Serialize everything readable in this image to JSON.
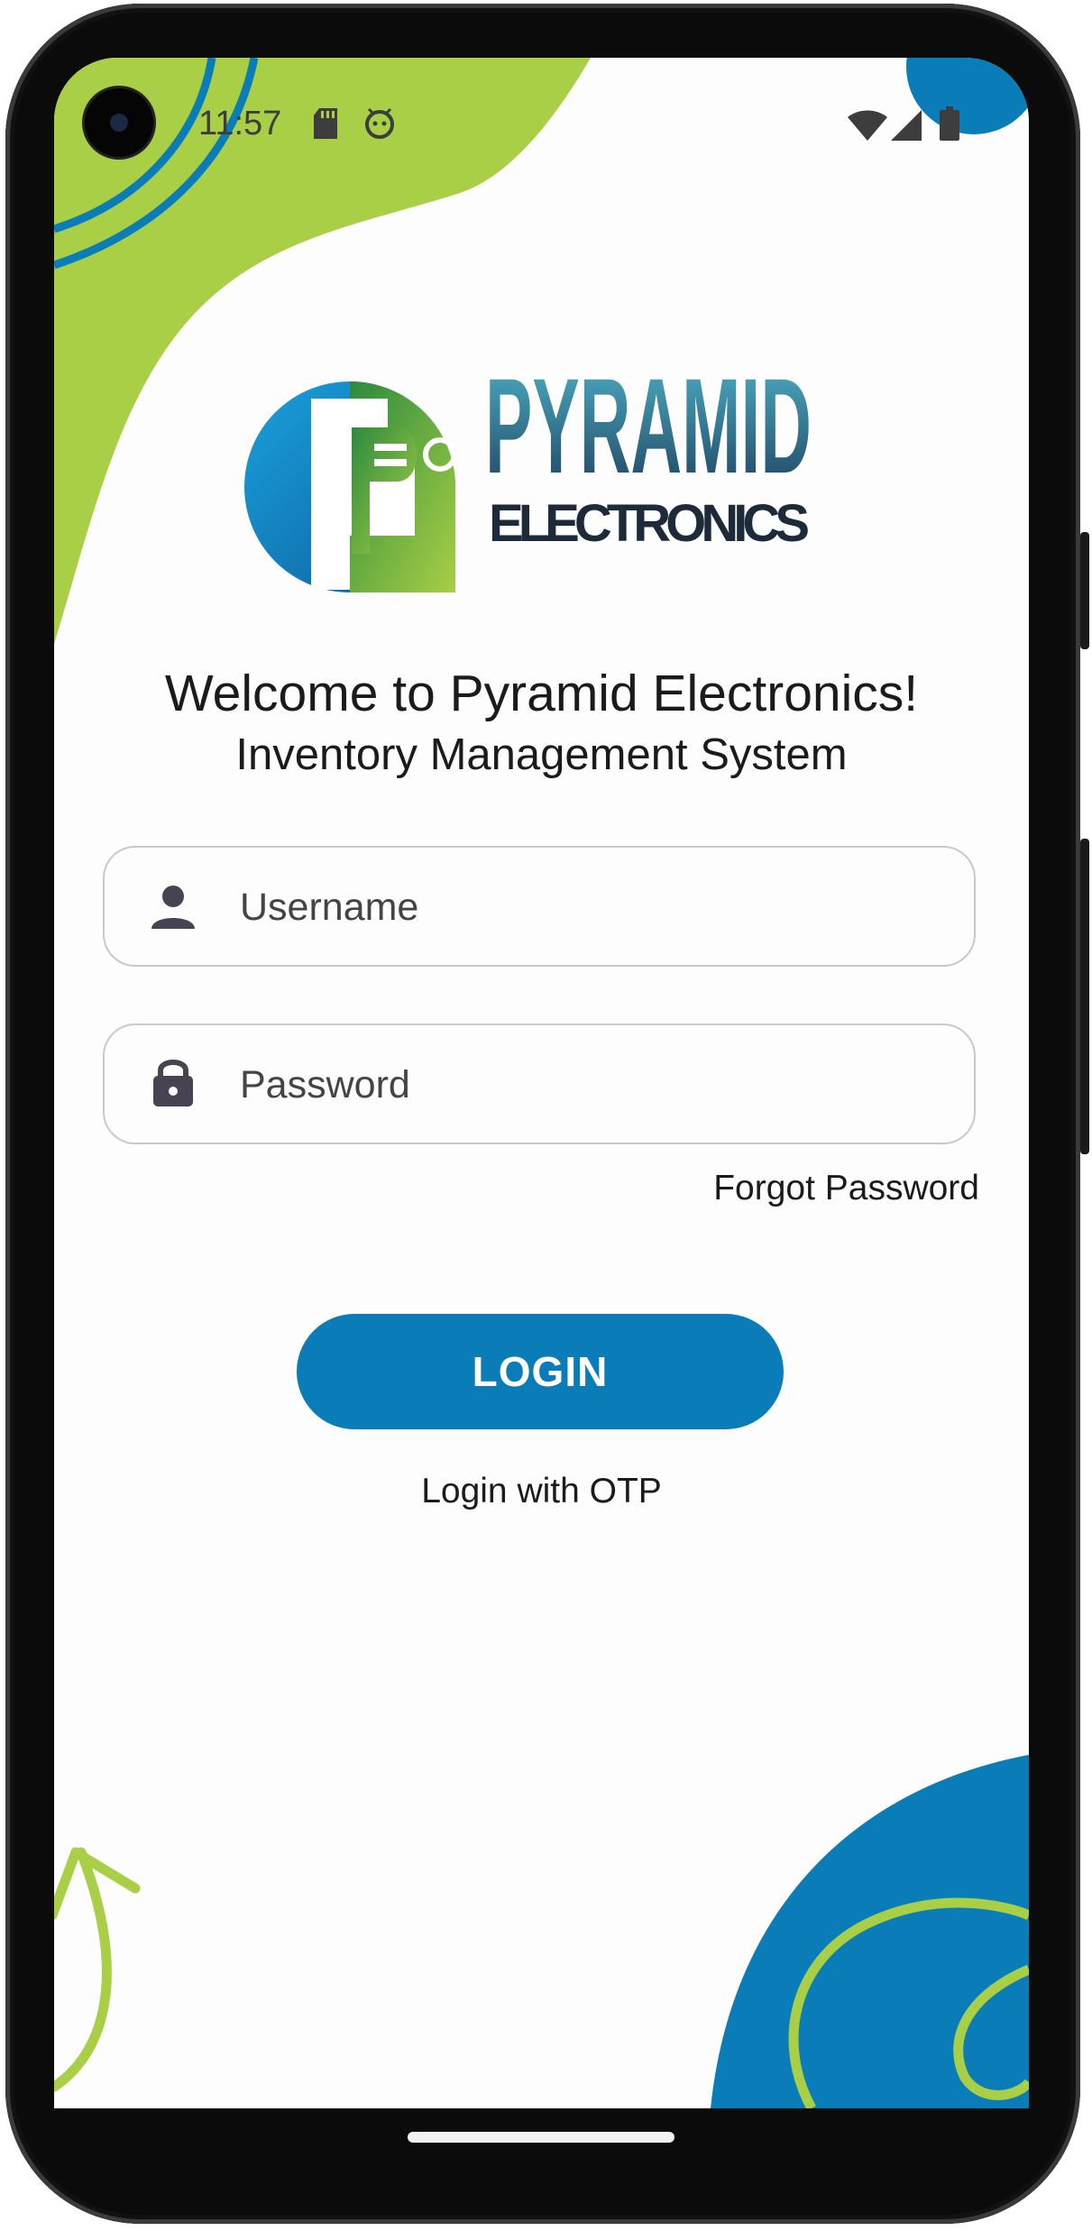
{
  "status_bar": {
    "time": "11:57",
    "left_icons": [
      "sd-card-icon",
      "android-face-icon"
    ],
    "right_icons": [
      "wifi-icon",
      "cell-signal-icon",
      "battery-icon"
    ]
  },
  "logo": {
    "name": "PYRAMID",
    "tagline": "ELECTRONICS"
  },
  "header": {
    "welcome": "Welcome to Pyramid Electronics!",
    "subtitle": "Inventory Management System"
  },
  "form": {
    "username_placeholder": "Username",
    "password_placeholder": "Password",
    "forgot_password": "Forgot Password",
    "login_button": "LOGIN",
    "otp_link": "Login with OTP"
  },
  "colors": {
    "accent_blue": "#0a7db8",
    "accent_green": "#a8cf45",
    "text": "#1b1b1b"
  }
}
